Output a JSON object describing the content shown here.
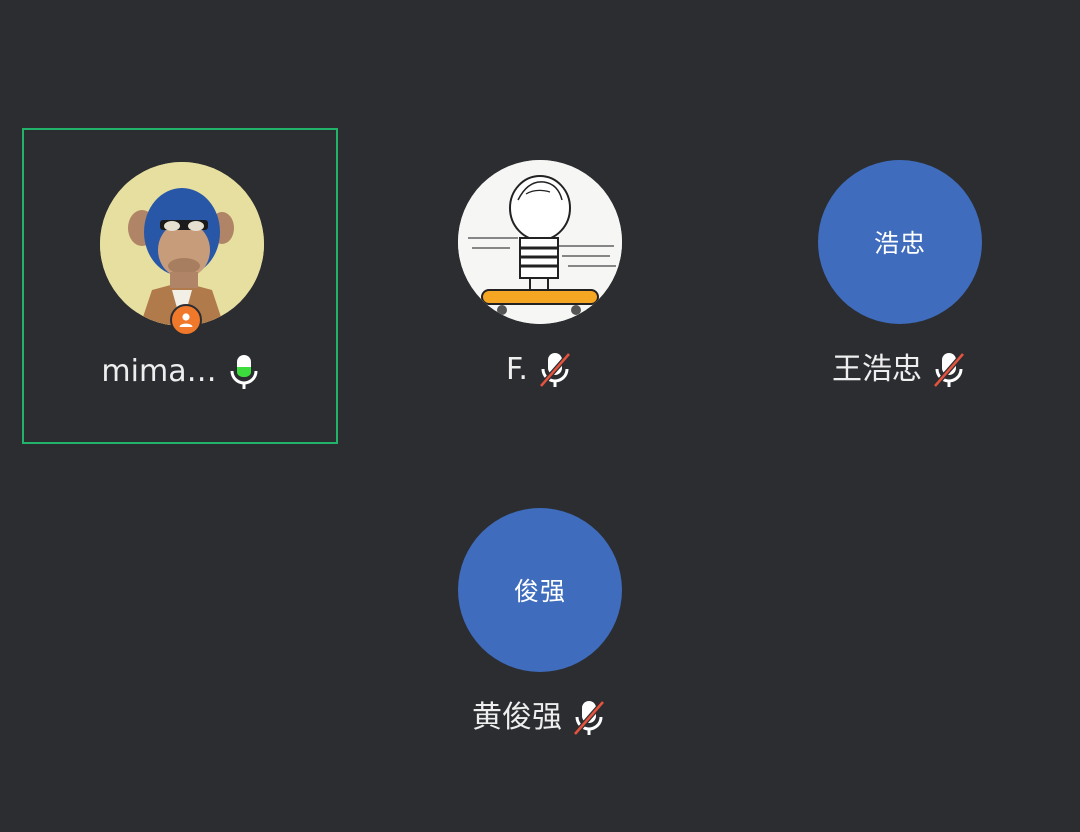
{
  "participants": [
    {
      "display_name": "mima…",
      "avatar_type": "image-ape",
      "is_host": true,
      "mic": "active",
      "speaking_level": 0.5,
      "active_speaker": true
    },
    {
      "display_name": "F.",
      "avatar_type": "image-skateboard-boy",
      "mic": "muted"
    },
    {
      "display_name": "王浩忠",
      "avatar_initials": "浩忠",
      "avatar_color": "#3f6cbd",
      "mic": "muted"
    },
    {
      "display_name": "黄俊强",
      "avatar_initials": "俊强",
      "avatar_color": "#3f6cbd",
      "mic": "muted"
    }
  ],
  "colors": {
    "background": "#2b2d31",
    "active_border": "#22b26a",
    "speaking_green": "#3ddc3d",
    "muted_slash": "#e5533d",
    "host_badge": "#f0782a"
  }
}
